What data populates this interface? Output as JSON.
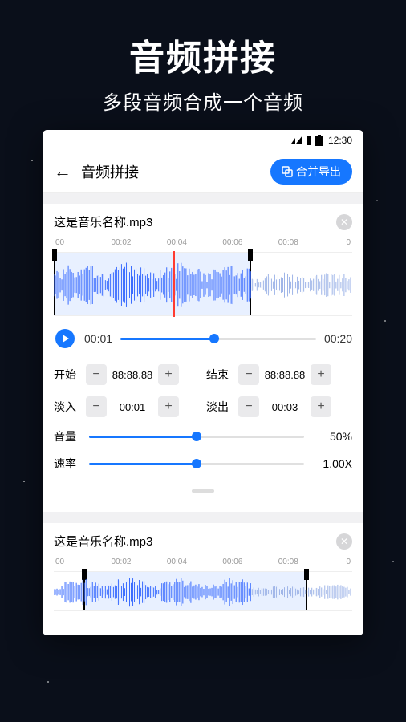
{
  "hero": {
    "title": "音频拼接",
    "subtitle": "多段音频合成一个音频"
  },
  "statusbar": {
    "time": "12:30"
  },
  "header": {
    "title": "音频拼接",
    "export_label": "合并导出"
  },
  "track1": {
    "filename": "这是音乐名称.mp3",
    "timeline": [
      "00",
      "00:02",
      "00:04",
      "00:06",
      "00:08",
      "0"
    ],
    "play_current": "00:01",
    "play_total": "00:20",
    "start_label": "开始",
    "start_value": "88:88.88",
    "end_label": "结束",
    "end_value": "88:88.88",
    "fadein_label": "淡入",
    "fadein_value": "00:01",
    "fadeout_label": "淡出",
    "fadeout_value": "00:03",
    "volume_label": "音量",
    "volume_value": "50%",
    "speed_label": "速率",
    "speed_value": "1.00X"
  },
  "track2": {
    "filename": "这是音乐名称.mp3",
    "timeline": [
      "00",
      "00:02",
      "00:04",
      "00:06",
      "00:08",
      "0"
    ]
  }
}
